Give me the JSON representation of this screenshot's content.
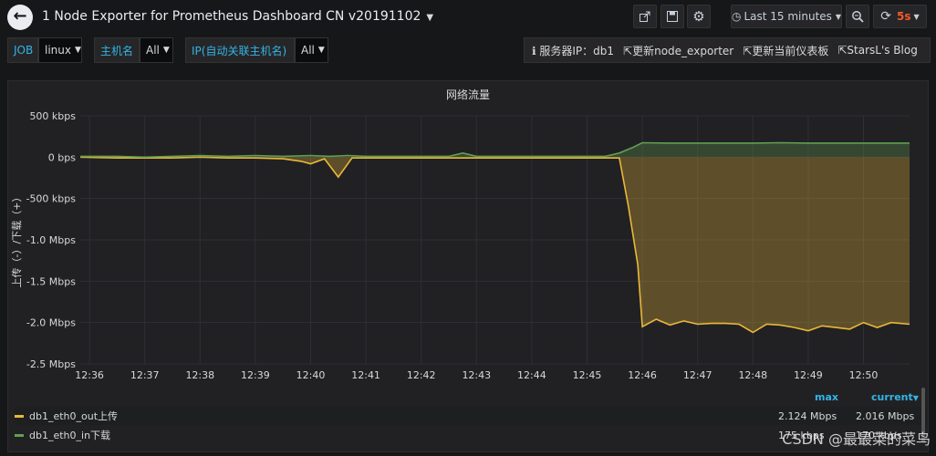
{
  "header": {
    "title": "1 Node Exporter for Prometheus Dashboard CN v20191102",
    "time_range": "Last 15 minutes",
    "refresh": "5s"
  },
  "variables": [
    {
      "label": "JOB",
      "value": "linux"
    },
    {
      "label": "主机名",
      "value": "All"
    },
    {
      "label": "IP(自动关联主机名)",
      "value": "All"
    }
  ],
  "links": {
    "server_info": "服务器IP：db1",
    "link1": "更新node_exporter",
    "link2": "更新当前仪表板",
    "link3": "StarsL's Blog"
  },
  "panel": {
    "title": "网络流量",
    "legend": {
      "max_header": "max",
      "current_header": "current",
      "rows": [
        {
          "name": "db1_eth0_out上传",
          "max": "2.124 Mbps",
          "current": "2.016 Mbps",
          "color": "#eab839"
        },
        {
          "name": "db1_eth0_in下载",
          "max": "175 kbps",
          "current": "170 kbps",
          "color": "#629e51"
        }
      ]
    }
  },
  "chart_data": {
    "type": "area",
    "title": "网络流量",
    "ylabel": "上传（-）/下载（+）",
    "y_unit": "Mbps",
    "ylim": [
      -2.5,
      0.5
    ],
    "y_ticks": [
      {
        "v": 0.5,
        "label": "500 kbps"
      },
      {
        "v": 0,
        "label": "0 bps"
      },
      {
        "v": -0.5,
        "label": "-500 kbps"
      },
      {
        "v": -1.0,
        "label": "-1.0 Mbps"
      },
      {
        "v": -1.5,
        "label": "-1.5 Mbps"
      },
      {
        "v": -2.0,
        "label": "-2.0 Mbps"
      },
      {
        "v": -2.5,
        "label": "-2.5 Mbps"
      }
    ],
    "x_ticks": [
      "12:36",
      "12:37",
      "12:38",
      "12:39",
      "12:40",
      "12:41",
      "12:42",
      "12:43",
      "12:44",
      "12:45",
      "12:46",
      "12:47",
      "12:48",
      "12:49",
      "12:50"
    ],
    "x_range": [
      "12:35:50",
      "12:50:50"
    ],
    "series": [
      {
        "name": "db1_eth0_in下载",
        "color": "#629e51",
        "x": [
          "12:35:50",
          "12:36:30",
          "12:37:00",
          "12:37:30",
          "12:38:00",
          "12:38:30",
          "12:39:00",
          "12:39:30",
          "12:40:00",
          "12:40:20",
          "12:40:40",
          "12:41:00",
          "12:41:30",
          "12:42:00",
          "12:42:30",
          "12:42:45",
          "12:43:00",
          "12:43:30",
          "12:44:00",
          "12:44:30",
          "12:45:00",
          "12:45:20",
          "12:45:35",
          "12:45:50",
          "12:46:00",
          "12:46:30",
          "12:47:00",
          "12:47:30",
          "12:48:00",
          "12:48:30",
          "12:49:00",
          "12:49:30",
          "12:50:00",
          "12:50:30",
          "12:50:50"
        ],
        "values": [
          0.01,
          0.01,
          0.0,
          0.01,
          0.02,
          0.01,
          0.02,
          0.01,
          0.02,
          0.01,
          0.02,
          0.01,
          0.01,
          0.01,
          0.01,
          0.05,
          0.01,
          0.01,
          0.01,
          0.01,
          0.01,
          0.01,
          0.05,
          0.12,
          0.175,
          0.17,
          0.17,
          0.17,
          0.17,
          0.175,
          0.17,
          0.17,
          0.17,
          0.17,
          0.17
        ]
      },
      {
        "name": "db1_eth0_out上传",
        "color": "#eab839",
        "x": [
          "12:35:50",
          "12:36:30",
          "12:37:00",
          "12:37:30",
          "12:38:00",
          "12:38:30",
          "12:39:00",
          "12:39:30",
          "12:39:50",
          "12:40:00",
          "12:40:15",
          "12:40:30",
          "12:40:45",
          "12:41:00",
          "12:41:30",
          "12:42:00",
          "12:42:30",
          "12:43:00",
          "12:43:30",
          "12:44:00",
          "12:44:30",
          "12:45:00",
          "12:45:20",
          "12:45:35",
          "12:45:45",
          "12:45:55",
          "12:46:00",
          "12:46:15",
          "12:46:30",
          "12:46:45",
          "12:47:00",
          "12:47:15",
          "12:47:30",
          "12:47:45",
          "12:48:00",
          "12:48:15",
          "12:48:30",
          "12:48:45",
          "12:49:00",
          "12:49:15",
          "12:49:30",
          "12:49:45",
          "12:50:00",
          "12:50:15",
          "12:50:30",
          "12:50:50"
        ],
        "values": [
          0.0,
          -0.01,
          -0.01,
          -0.01,
          0.0,
          -0.01,
          -0.01,
          -0.02,
          -0.05,
          -0.08,
          -0.02,
          -0.24,
          -0.01,
          -0.01,
          -0.01,
          -0.01,
          -0.01,
          -0.01,
          -0.01,
          -0.01,
          -0.01,
          -0.01,
          -0.01,
          -0.01,
          -0.6,
          -1.3,
          -2.05,
          -1.96,
          -2.03,
          -1.98,
          -2.02,
          -2.01,
          -2.01,
          -2.02,
          -2.12,
          -2.02,
          -2.03,
          -2.06,
          -2.1,
          -2.04,
          -2.06,
          -2.08,
          -2.0,
          -2.06,
          -2.0,
          -2.02
        ]
      }
    ],
    "grid": true,
    "legend_position": "bottom"
  },
  "watermark": "CSDN @最最菜的菜鸟"
}
